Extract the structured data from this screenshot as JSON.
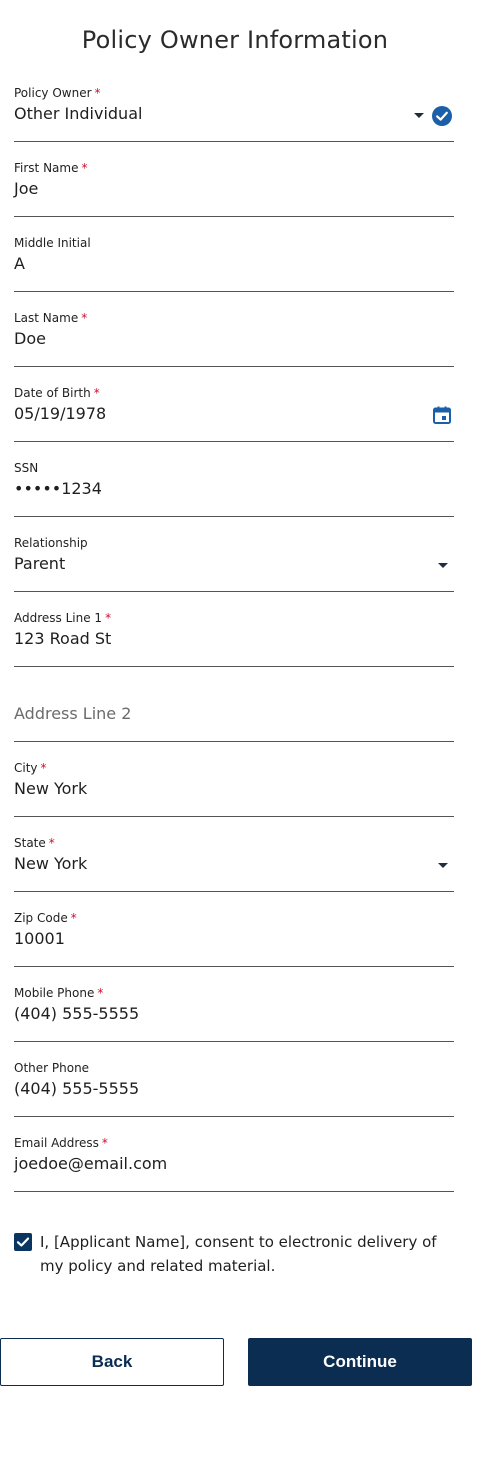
{
  "page": {
    "title": "Policy Owner Information"
  },
  "required_mark": "*",
  "fields": {
    "policy_owner": {
      "label": "Policy Owner",
      "value": "Other Individual",
      "required": true
    },
    "first_name": {
      "label": "First Name",
      "value": "Joe",
      "required": true
    },
    "middle_initial": {
      "label": "Middle Initial",
      "value": "A",
      "required": false
    },
    "last_name": {
      "label": "Last Name",
      "value": "Doe",
      "required": true
    },
    "dob": {
      "label": "Date of Birth",
      "value": "05/19/1978",
      "required": true
    },
    "ssn": {
      "label": "SSN",
      "value": "•••••1234",
      "required": false
    },
    "relationship": {
      "label": "Relationship",
      "value": "Parent",
      "required": false
    },
    "address1": {
      "label": "Address Line 1",
      "value": "123 Road St",
      "required": true
    },
    "address2": {
      "placeholder": "Address Line 2",
      "value": "",
      "required": false
    },
    "city": {
      "label": "City",
      "value": "New York",
      "required": true
    },
    "state": {
      "label": "State",
      "value": "New York",
      "required": true
    },
    "zip": {
      "label": "Zip Code",
      "value": "10001",
      "required": true
    },
    "mobile_phone": {
      "label": "Mobile Phone",
      "value": "(404) 555-5555",
      "required": true
    },
    "other_phone": {
      "label": "Other Phone",
      "value": "(404) 555-5555",
      "required": false
    },
    "email": {
      "label": "Email Address",
      "value": "joedoe@email.com",
      "required": true
    }
  },
  "consent": {
    "checked": true,
    "text": "I, [Applicant Name], consent to electronic delivery of my policy and related material."
  },
  "buttons": {
    "back": "Back",
    "continue": "Continue"
  },
  "colors": {
    "primary": "#0b2d52",
    "required": "#c8102e",
    "check_badge": "#1b5fa8"
  },
  "icons": {
    "policy_owner": [
      "chevron-down-icon",
      "check-circle-icon"
    ],
    "dob": "calendar-icon",
    "relationship": "chevron-down-icon",
    "state": "chevron-down-icon",
    "consent": "checkbox-checked-icon"
  }
}
